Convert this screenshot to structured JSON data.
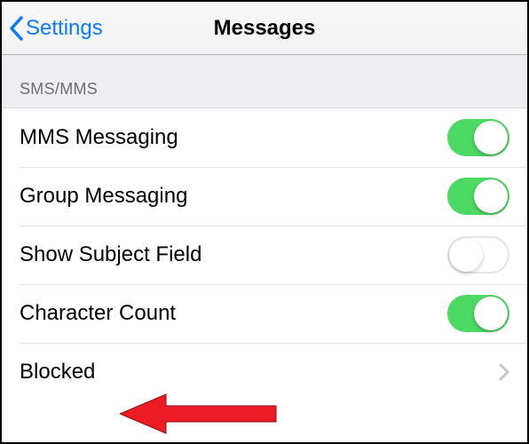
{
  "header": {
    "back_label": "Settings",
    "title": "Messages"
  },
  "section": {
    "heading": "SMS/MMS"
  },
  "rows": {
    "mms": {
      "label": "MMS Messaging",
      "on": true
    },
    "group": {
      "label": "Group Messaging",
      "on": true
    },
    "subject": {
      "label": "Show Subject Field",
      "on": false
    },
    "charcount": {
      "label": "Character Count",
      "on": true
    },
    "blocked": {
      "label": "Blocked"
    }
  },
  "colors": {
    "accent": "#0a7aff",
    "toggle_on": "#4cd964",
    "annotation_arrow": "#ec1c24"
  }
}
